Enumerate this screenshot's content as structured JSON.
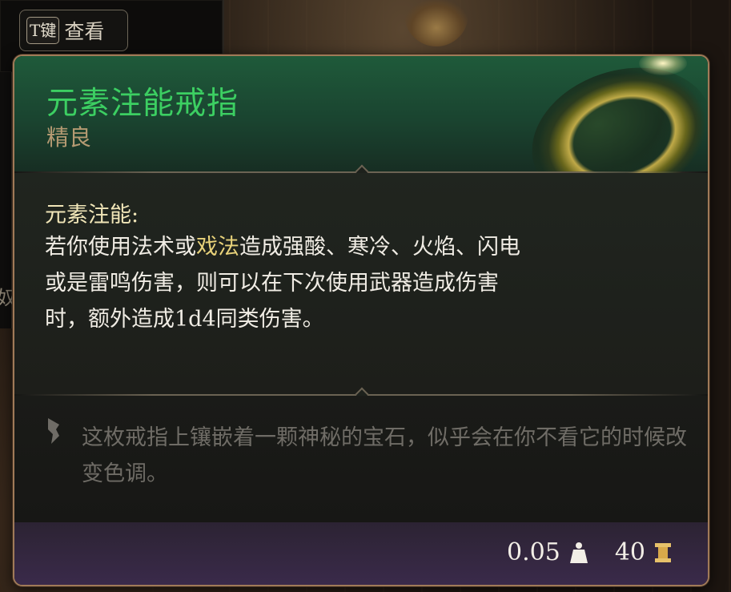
{
  "view_button": {
    "key": "T键",
    "label": "查看"
  },
  "side_glyph": "奴",
  "item": {
    "name": "元素注能戒指",
    "rarity": "精良",
    "passive_name": "元素注能:",
    "description_parts": [
      {
        "text": "若你使用法术或",
        "highlight": false
      },
      {
        "text": "戏法",
        "highlight": true
      },
      {
        "text": "造成强酸、寒冷、火焰、闪电或是雷鸣伤害，则可以在下次使用武器造成伤害时，额外造成1d4同类伤害。",
        "highlight": false
      }
    ],
    "flavor_text": "这枚戒指上镶嵌着一颗神秘的宝石，似乎会在你不看它的时候改变色调。",
    "weight": "0.05",
    "value": "40"
  },
  "colors": {
    "title_green": "#3ccf62",
    "rarity_tan": "#b49a72",
    "highlight_gold": "#e8d27a",
    "flavor_gray": "#6f6c66",
    "footer_purple": "#3a2a4a"
  },
  "icons": [
    "quill-icon",
    "weight-icon",
    "gold-icon",
    "ring-image"
  ]
}
